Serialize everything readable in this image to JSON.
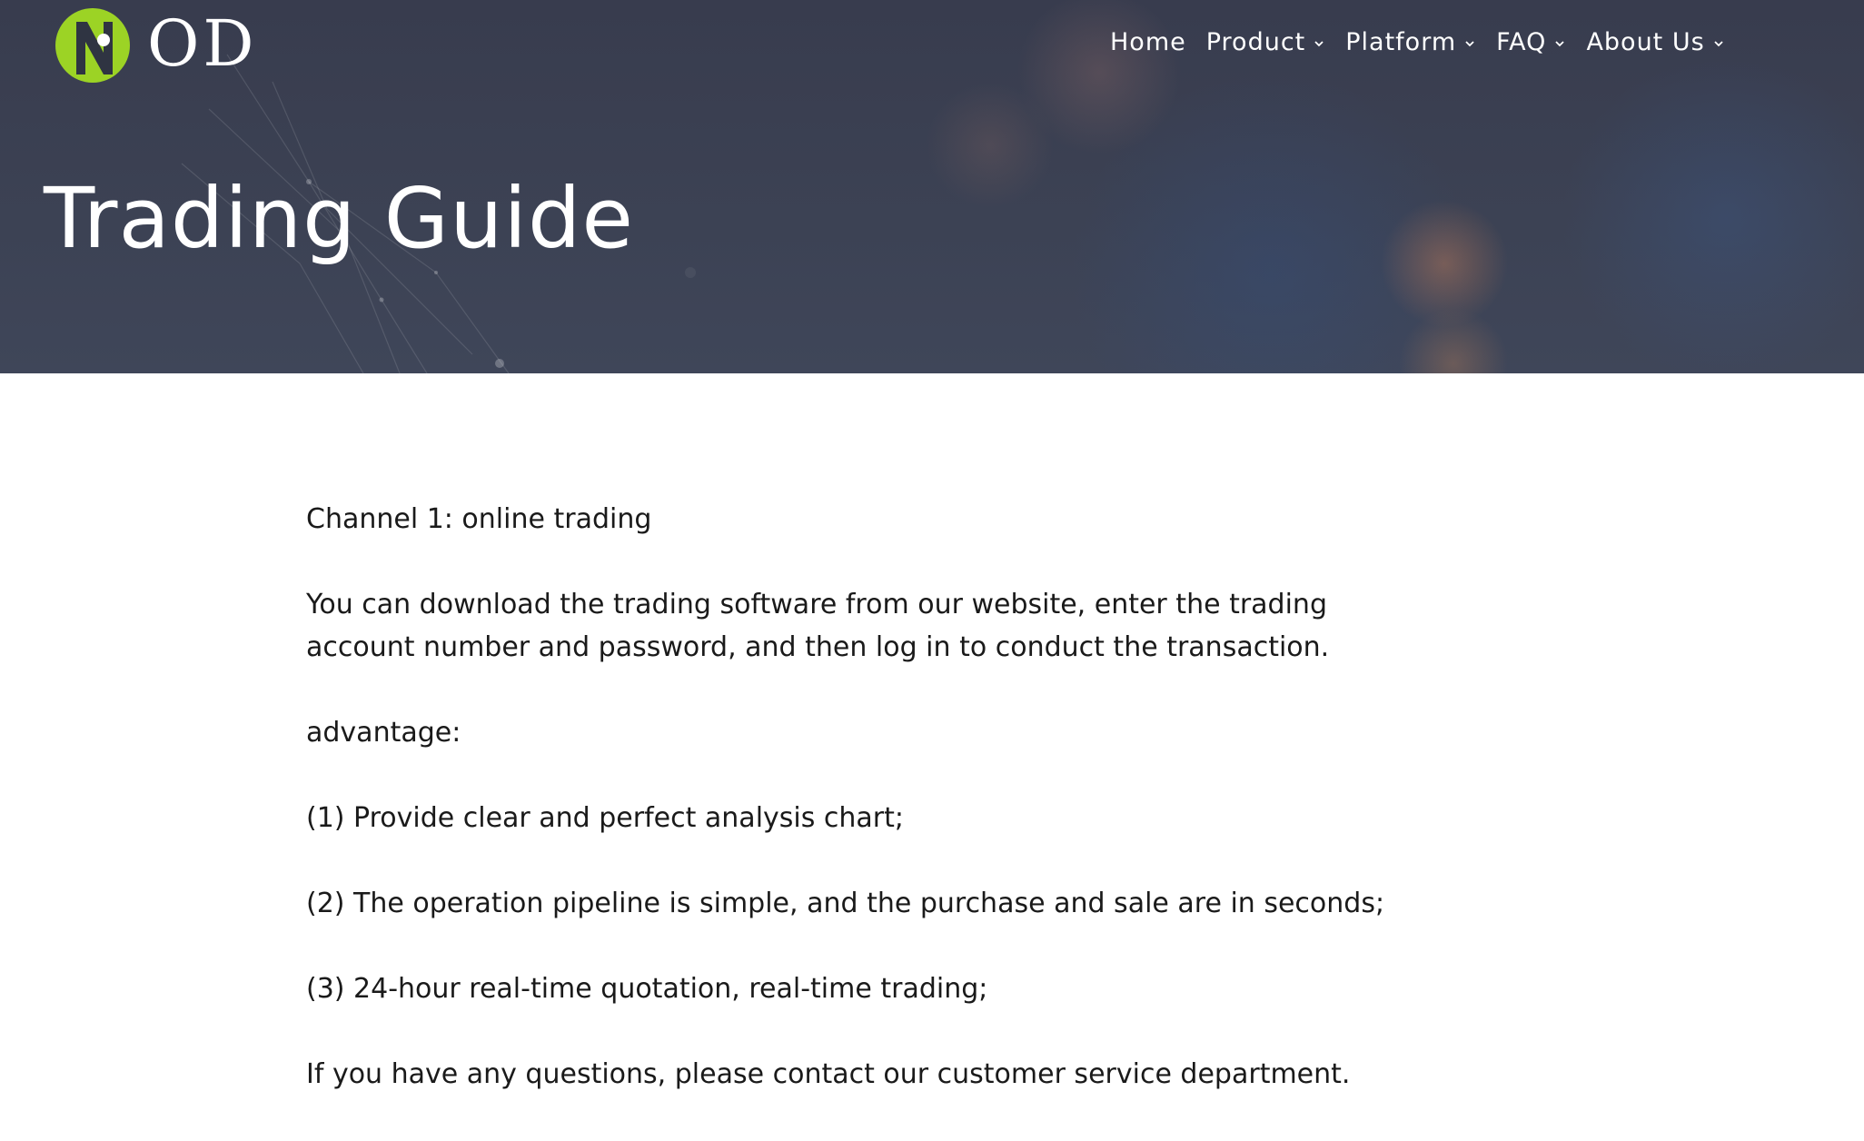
{
  "brand": {
    "name": "OD",
    "mark_color": "#9cd325"
  },
  "nav": {
    "items": [
      {
        "label": "Home",
        "has_dropdown": false
      },
      {
        "label": "Product",
        "has_dropdown": true
      },
      {
        "label": "Platform",
        "has_dropdown": true
      },
      {
        "label": "FAQ",
        "has_dropdown": true
      },
      {
        "label": "About Us",
        "has_dropdown": true
      }
    ]
  },
  "hero": {
    "title": "Trading Guide"
  },
  "content": {
    "paragraphs": [
      "Channel 1: online trading",
      "You can download the trading software from our website, enter the trading account number and password, and then log in to conduct the transaction.",
      "advantage:",
      "(1) Provide clear and perfect analysis chart;",
      "(2) The operation pipeline is simple, and the purchase and sale are in seconds;",
      "(3) 24-hour real-time quotation, real-time trading;",
      "If you have any questions, please contact our customer service department."
    ]
  },
  "colors": {
    "hero_bg": "#3c4254",
    "text": "#1a1a1a",
    "nav_text": "#ffffff"
  }
}
